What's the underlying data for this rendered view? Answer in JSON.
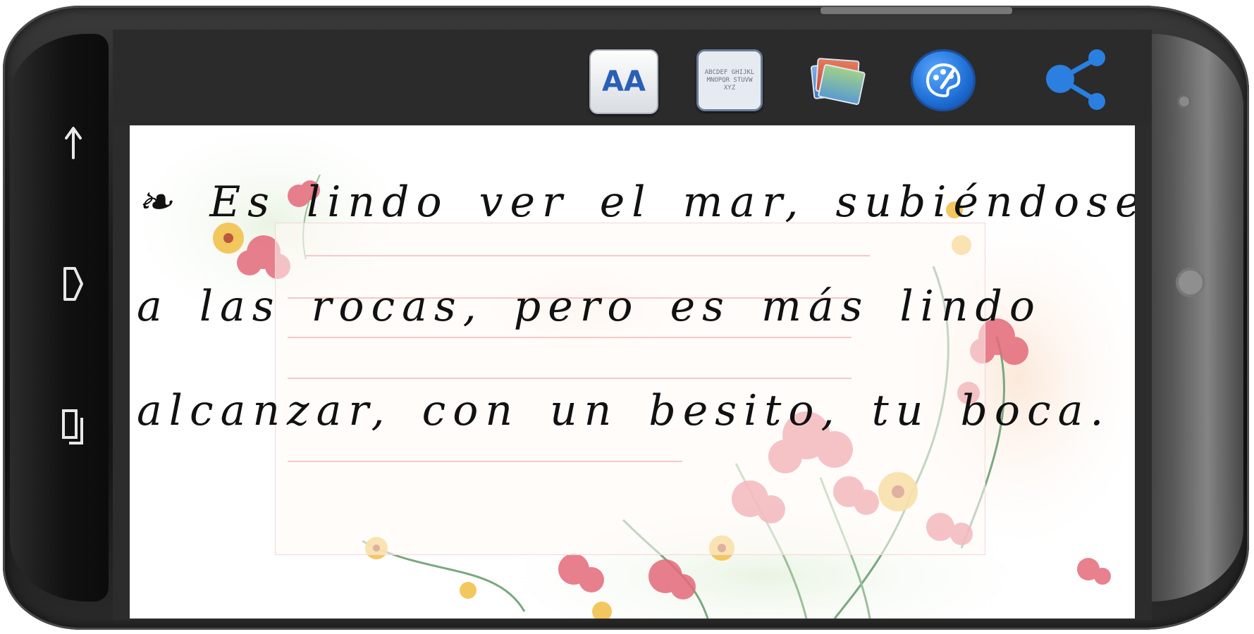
{
  "nav_bar": {
    "icons": [
      "back-icon",
      "home-icon",
      "recent-apps-icon"
    ]
  },
  "toolbar": {
    "font_button_label": "AA",
    "alphabet_button_text": "ABCDEF GHIJKL MNOPQR STUVW XYZ",
    "icons": [
      "font-size-icon",
      "alphabet-icon",
      "gallery-icon",
      "palette-icon",
      "share-icon"
    ]
  },
  "poem": {
    "lines": [
      "❧ Es lindo ver el mar, subiéndose",
      "a las rocas, pero es más lindo",
      "alcanzar, con un besito, tu boca. ❦"
    ]
  },
  "colors": {
    "toolbar_bg": "#2b2b2b",
    "paper_bg": "#ffffff",
    "rule_line": "#f4c9c9",
    "accent_blue": "#2a7fe0",
    "text": "#111111"
  }
}
